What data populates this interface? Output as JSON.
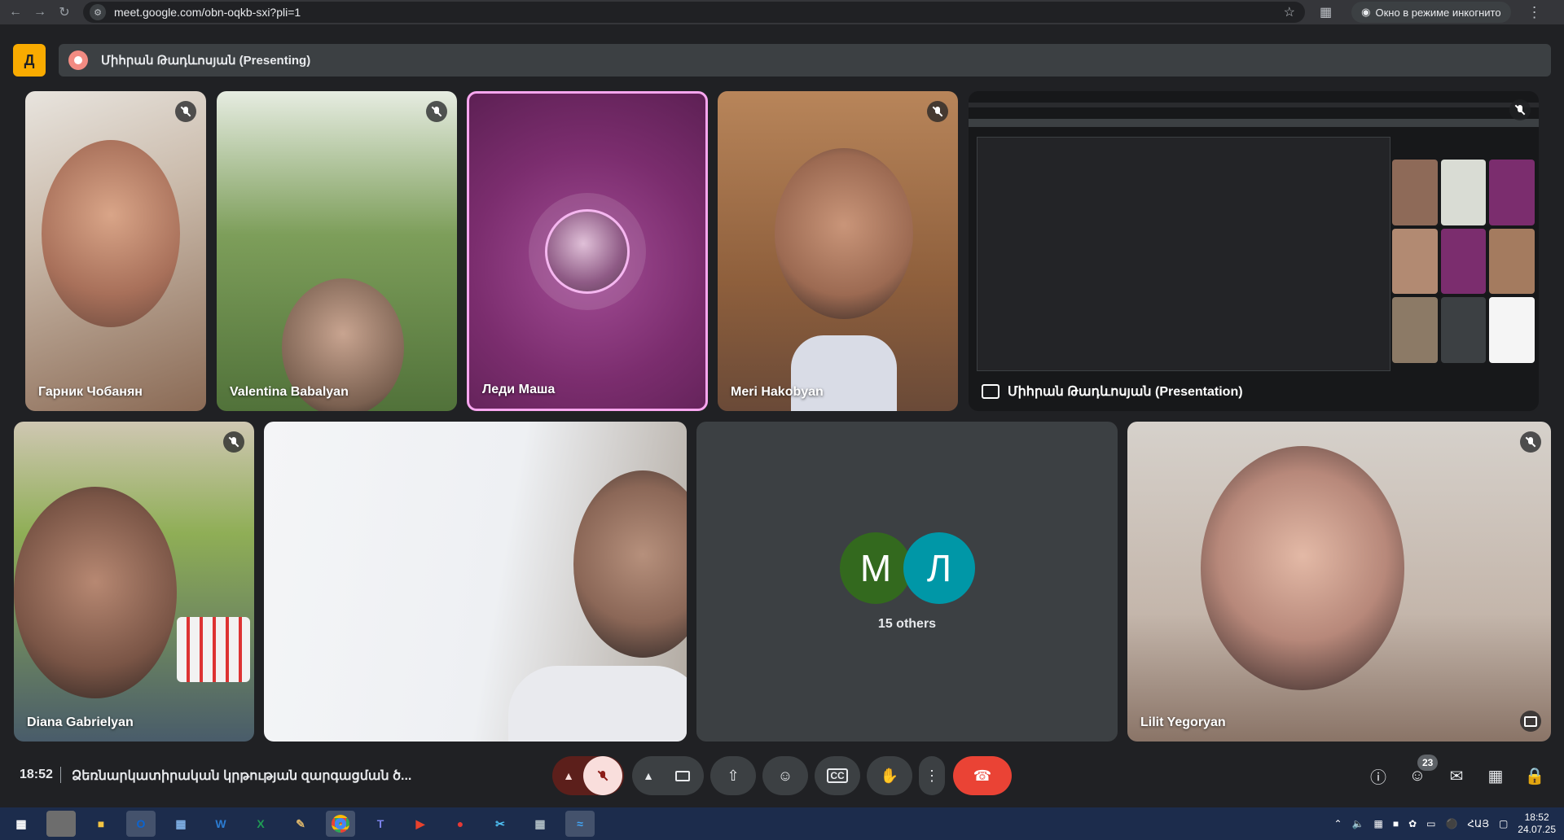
{
  "browser": {
    "url": "meet.google.com/obn-oqkb-sxi?pli=1",
    "incognito_label": "Окно в режиме инкогнито"
  },
  "presenting": {
    "logo_letter": "Д",
    "text": "Միհրան Թադևոսյան (Presenting)"
  },
  "tiles": [
    {
      "name": "Гарник Чобанян",
      "muted": true
    },
    {
      "name": "Valentina Babalyan",
      "muted": true
    },
    {
      "name": "Леди Маша",
      "muted": false,
      "speaking": true
    },
    {
      "name": "Meri Hakobyan",
      "muted": true
    },
    {
      "name": "Միհրան Թադևոսյան (Presentation)",
      "muted": true
    },
    {
      "name": "Diana Gabrielyan",
      "muted": true
    },
    {
      "name": "",
      "muted": false
    },
    {
      "name": "15 others",
      "initials": [
        "M",
        "Л"
      ],
      "colors": [
        "#33691e",
        "#0097a7"
      ]
    },
    {
      "name": "Lilit Yegoryan",
      "muted": true
    }
  ],
  "controls": {
    "time": "18:52",
    "meeting_title": "Ձեռնարկատիրական կրթության զարգացման ծ...",
    "people_count": "23"
  },
  "taskbar": {
    "language": "ՀԱՅ",
    "time": "18:52",
    "date": "24.07.25"
  }
}
